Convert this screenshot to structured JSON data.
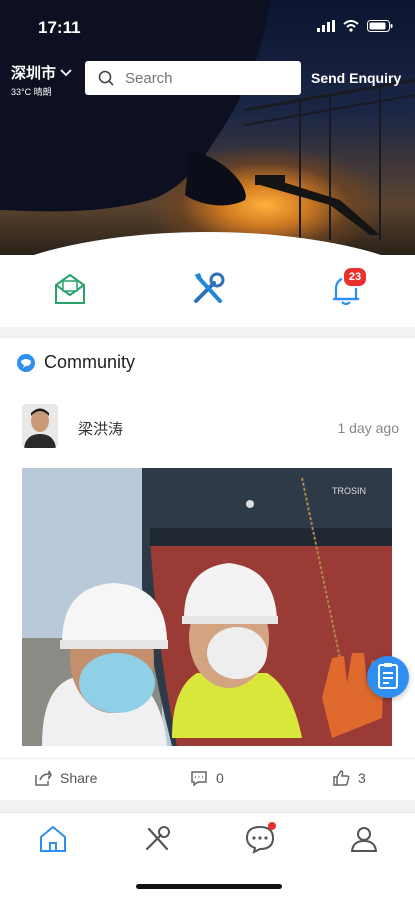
{
  "status_bar": {
    "time": "17:11"
  },
  "header": {
    "city": "深圳市",
    "weather": "33°C 晴朗",
    "search_placeholder": "Search",
    "send_enquiry": "Send Enquiry"
  },
  "quick_actions": {
    "items": [
      {
        "icon": "mail-envelope-icon"
      },
      {
        "icon": "tools-icon"
      },
      {
        "icon": "bell-icon",
        "badge": "23"
      }
    ]
  },
  "community": {
    "title": "Community",
    "post": {
      "author": "梁洪涛",
      "time_ago": "1 day ago",
      "share_label": "Share",
      "comments": "0",
      "likes": "3"
    }
  },
  "tabbar": {
    "items": [
      {
        "icon": "home-icon",
        "active": true
      },
      {
        "icon": "tools-icon"
      },
      {
        "icon": "chat-icon",
        "dot": true
      },
      {
        "icon": "profile-icon"
      }
    ]
  },
  "colors": {
    "accent": "#2f8ff0",
    "badge": "#e8302f",
    "green_icon": "#27a36a"
  }
}
